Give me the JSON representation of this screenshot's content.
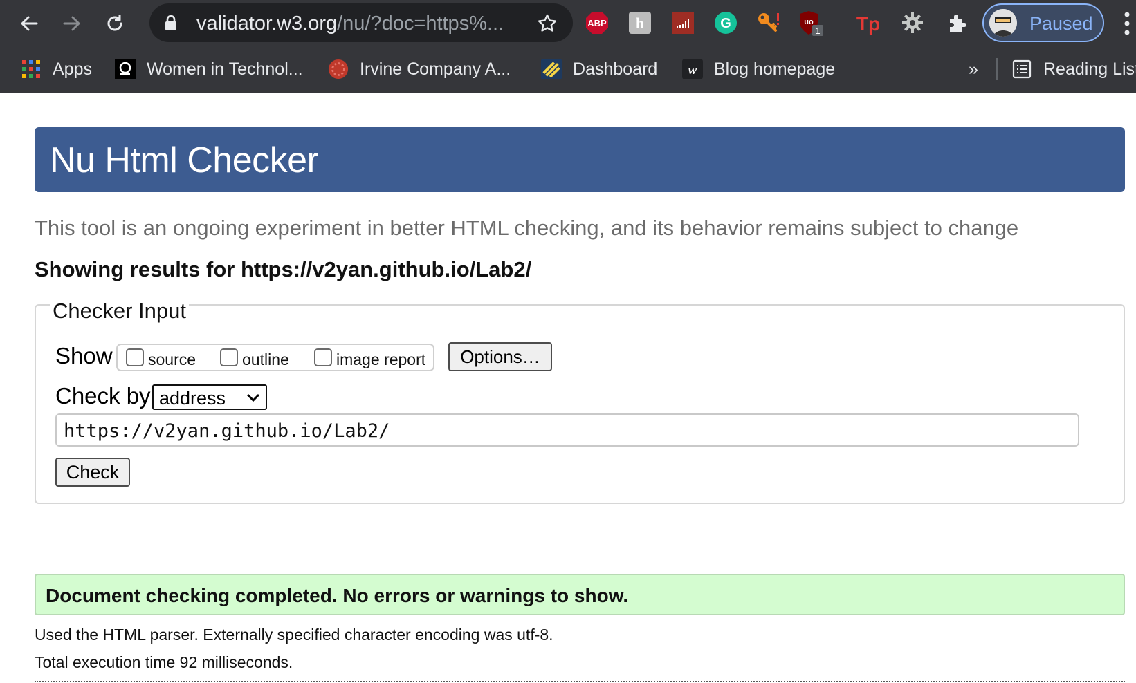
{
  "browser": {
    "omnibox": {
      "host": "validator.w3.org",
      "path": "/nu/?doc=https%..."
    },
    "extensions": [
      {
        "icon": "adblock-plus-icon",
        "text": "ABP"
      },
      {
        "icon": "hypothesis-icon",
        "text": "h"
      },
      {
        "icon": "signal-bars-icon",
        "text": ""
      },
      {
        "icon": "grammarly-icon",
        "text": "G"
      },
      {
        "icon": "key-icon",
        "text": ""
      },
      {
        "icon": "ublock-icon",
        "text": "uo",
        "badge": "1"
      },
      {
        "icon": "tp-icon",
        "text": "Tp"
      },
      {
        "icon": "gear-icon",
        "text": ""
      },
      {
        "icon": "puzzle-icon",
        "text": ""
      }
    ],
    "profile": {
      "label": "Paused"
    }
  },
  "bookmarks": {
    "items": [
      {
        "label": "Apps",
        "icon": "apps-grid-icon"
      },
      {
        "label": "Women in Technol...",
        "icon": "women-in-tech-icon"
      },
      {
        "label": "Irvine Company A...",
        "icon": "irvine-company-icon"
      },
      {
        "label": "Dashboard",
        "icon": "dashboard-icon"
      },
      {
        "label": "Blog homepage",
        "icon": "wordpress-icon"
      }
    ],
    "overflow": "»",
    "reading_list": "Reading List"
  },
  "page": {
    "title": "Nu Html Checker",
    "tagline": "This tool is an ongoing experiment in better HTML checking, and its behavior remains subject to change",
    "results_heading": "Showing results for https://v2yan.github.io/Lab2/",
    "checker": {
      "legend": "Checker Input",
      "show_label": "Show",
      "checkboxes": [
        {
          "label": "source",
          "checked": false
        },
        {
          "label": "outline",
          "checked": false
        },
        {
          "label": "image report",
          "checked": false
        }
      ],
      "options_button": "Options…",
      "check_by_label": "Check by",
      "check_by_value": "address",
      "url_value": "https://v2yan.github.io/Lab2/",
      "check_button": "Check"
    },
    "result": {
      "message": "Document checking completed. No errors or warnings to show.",
      "parser_info": "Used the HTML parser. Externally specified character encoding was utf-8.",
      "timing": "Total execution time 92 milliseconds."
    },
    "colors": {
      "header_bg": "#3d5c91",
      "success_bg": "#d4fcd0",
      "chrome_bg": "#35363a"
    }
  }
}
